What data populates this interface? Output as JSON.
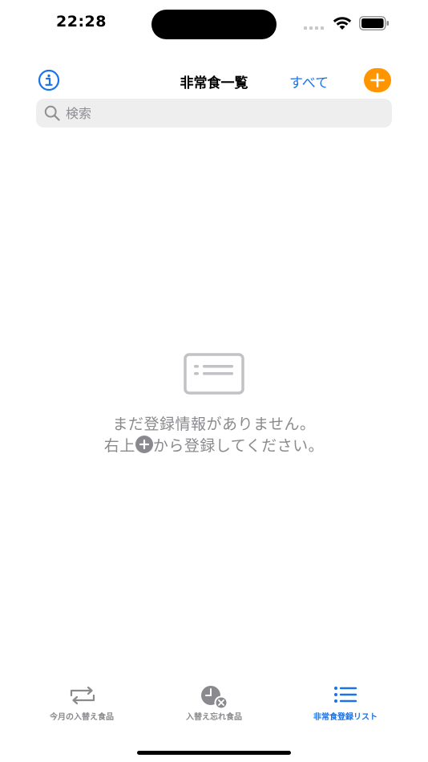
{
  "status_bar": {
    "time": "22:28"
  },
  "nav": {
    "title": "非常食一覧",
    "all_label": "すべて"
  },
  "search": {
    "placeholder": "検索"
  },
  "empty_state": {
    "line1": "まだ登録情報がありません。",
    "line2_prefix": "右上",
    "line2_suffix": "から登録してください。"
  },
  "tabs": [
    {
      "label": "今月の入替え食品",
      "icon": "arrows-swap-icon",
      "active": false
    },
    {
      "label": "入替え忘れ食品",
      "icon": "clock-x-icon",
      "active": false
    },
    {
      "label": "非常食登録リスト",
      "icon": "list-icon",
      "active": true
    }
  ],
  "colors": {
    "accent_blue": "#1a73e8",
    "add_orange": "#ff9500",
    "inactive_gray": "#8a8a8e"
  }
}
